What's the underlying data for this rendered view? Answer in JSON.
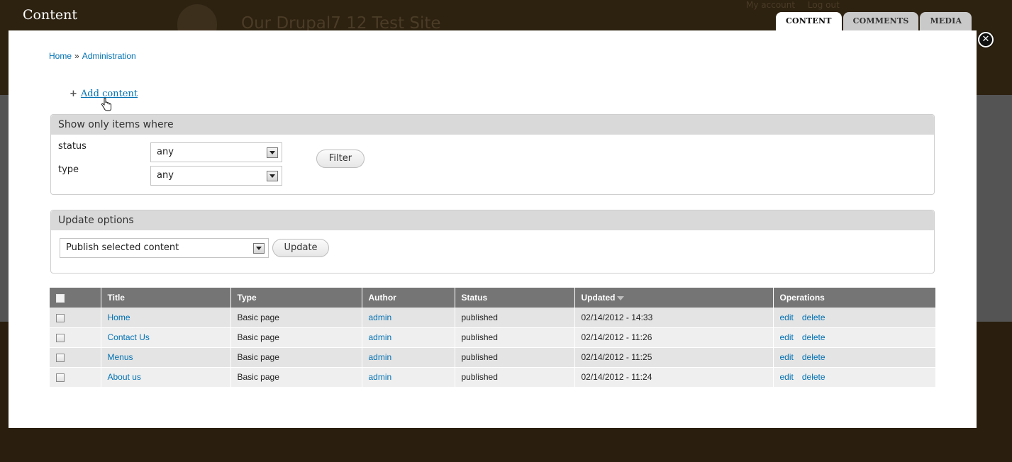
{
  "background": {
    "site_name": "Our Drupal7 12 Test Site",
    "user_links": [
      "My account",
      "Log out"
    ]
  },
  "overlay": {
    "title": "Content",
    "tabs": [
      {
        "label": "CONTENT",
        "active": true
      },
      {
        "label": "COMMENTS",
        "active": false
      },
      {
        "label": "MEDIA",
        "active": false
      }
    ],
    "close_icon": "close-icon"
  },
  "breadcrumb": {
    "items": [
      "Home",
      "Administration"
    ],
    "separator": "»"
  },
  "actions": {
    "add_content": "Add content"
  },
  "filter": {
    "legend": "Show only items where",
    "fields": [
      {
        "label": "status",
        "value": "any"
      },
      {
        "label": "type",
        "value": "any"
      }
    ],
    "button": "Filter"
  },
  "update": {
    "legend": "Update options",
    "selected": "Publish selected content",
    "button": "Update"
  },
  "table": {
    "headers": [
      "Title",
      "Type",
      "Author",
      "Status",
      "Updated",
      "Operations"
    ],
    "rows": [
      {
        "title": "Home",
        "type": "Basic page",
        "author": "admin",
        "status": "published",
        "updated": "02/14/2012 - 14:33",
        "ops": [
          "edit",
          "delete"
        ]
      },
      {
        "title": "Contact Us",
        "type": "Basic page",
        "author": "admin",
        "status": "published",
        "updated": "02/14/2012 - 11:26",
        "ops": [
          "edit",
          "delete"
        ]
      },
      {
        "title": "Menus",
        "type": "Basic page",
        "author": "admin",
        "status": "published",
        "updated": "02/14/2012 - 11:25",
        "ops": [
          "edit",
          "delete"
        ]
      },
      {
        "title": "About us",
        "type": "Basic page",
        "author": "admin",
        "status": "published",
        "updated": "02/14/2012 - 11:24",
        "ops": [
          "edit",
          "delete"
        ]
      }
    ]
  },
  "colors": {
    "link": "#0071b3",
    "header_bg": "#2d2110",
    "table_header": "#757575"
  }
}
